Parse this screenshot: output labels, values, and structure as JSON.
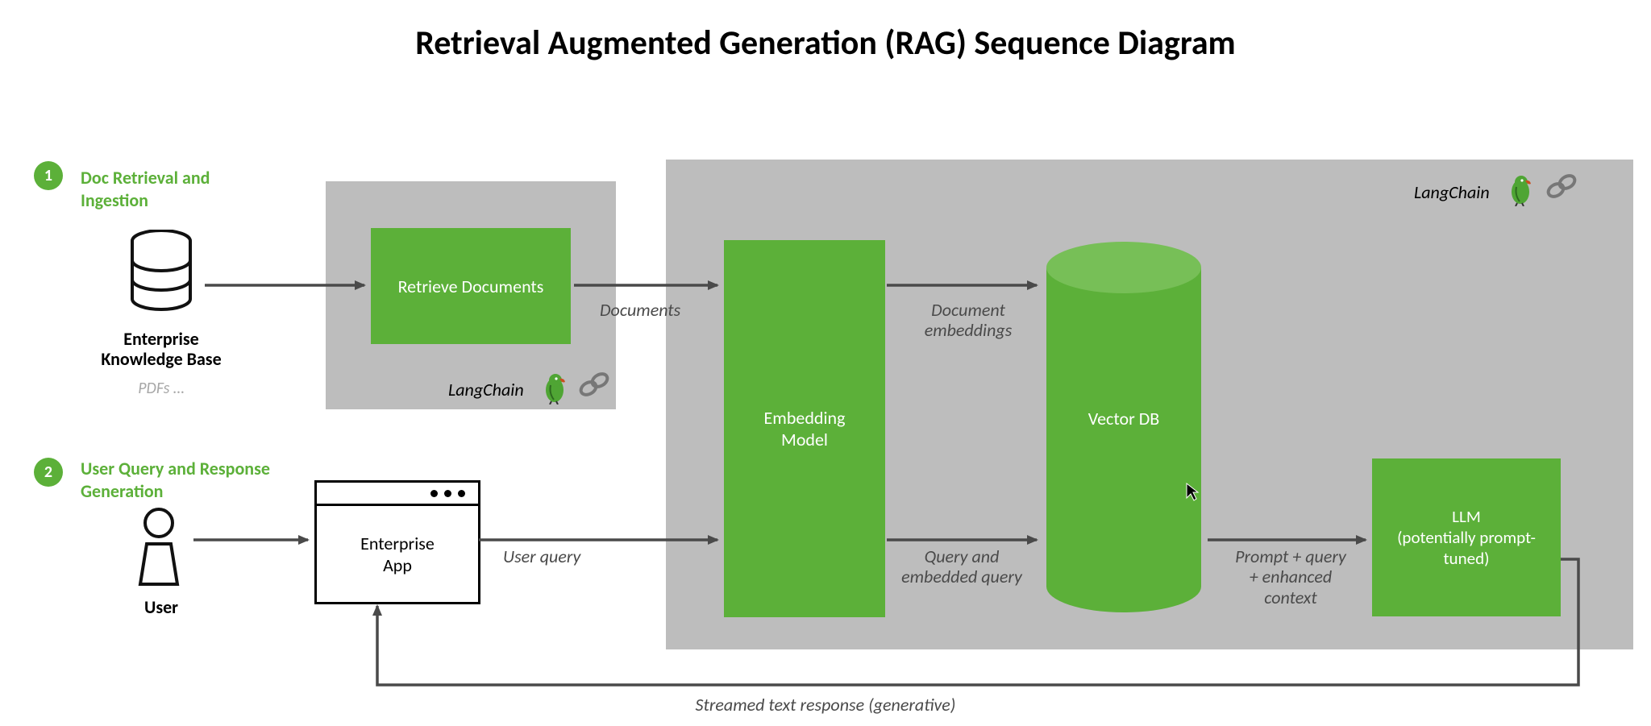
{
  "title": "Retrieval Augmented Generation (RAG) Sequence Diagram",
  "steps": {
    "s1": {
      "num": "1",
      "label": "Doc Retrieval and\nIngestion"
    },
    "s2": {
      "num": "2",
      "label": "User Query and Response\nGeneration"
    }
  },
  "kb": {
    "title": "Enterprise\nKnowledge Base",
    "sub": "PDFs …"
  },
  "user_label": "User",
  "app_label": "Enterprise\nApp",
  "blocks": {
    "retrieve": "Retrieve Documents",
    "embed": "Embedding\nModel",
    "vector": "Vector DB",
    "llm": "LLM\n(potentially prompt-\ntuned)"
  },
  "langchain": "LangChain",
  "flows": {
    "documents": "Documents",
    "doc_emb": "Document\nembeddings",
    "user_query": "User query",
    "query_emb": "Query and\nembedded query",
    "prompt_ctx": "Prompt + query\n+ enhanced\ncontext",
    "response": "Streamed text response (generative)"
  },
  "colors": {
    "green": "#5cb039",
    "grey": "#bdbdbd"
  }
}
